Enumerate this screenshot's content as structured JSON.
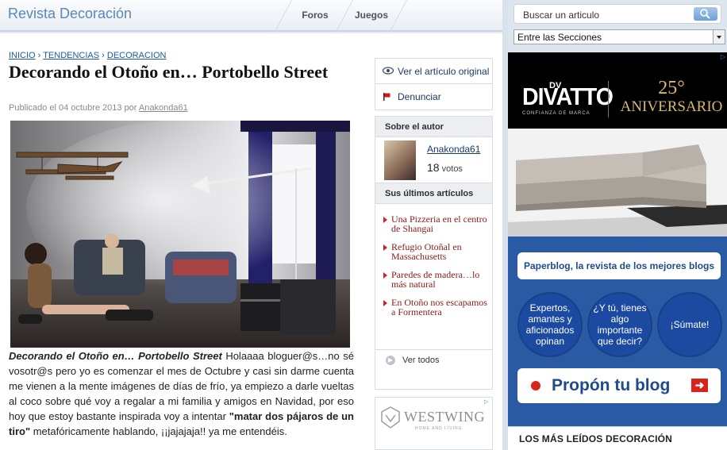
{
  "header": {
    "site_title": "Revista Decoración",
    "nav": [
      "Foros",
      "Juegos"
    ]
  },
  "breadcrumb": [
    "INICIO",
    "TENDENCIAS",
    "DECORACION"
  ],
  "article": {
    "title": "Decorando el Otoño en… Portobello Street",
    "meta_prefix": "Publicado el 04 octubre 2013 por",
    "author": "Anakonda61",
    "lead": "Decorando el Otoño en…  Portobello Street",
    "body_1": " Holaaaa bloguer@s…no sé vosotr@s pero yo es comenzar el mes de Octubre y casi sin darme cuenta me vienen a la mente imágenes de días de frío, ya empiezo a darle vueltas al coco sobre qué voy a regalar a mi familia y amigos en Navidad, por eso hoy que estoy bastante inspirada voy a intentar ",
    "quote": "\"matar dos pájaros de un tiro\"",
    "body_2": " metafóricamente hablando, ¡¡jajajaja!! ya me entendéis."
  },
  "actions": {
    "view_original": "Ver el artículo original",
    "report": "Denunciar"
  },
  "author_box": {
    "heading": "Sobre el autor",
    "name": "Anakonda61",
    "votes": "18",
    "votes_label": "votos"
  },
  "latest": {
    "heading": "Sus últimos artículos",
    "items": [
      "Una Pizzeria en el centro de Shangai",
      "Refugio Otoñal en Massachusetts",
      "Paredes de madera…lo más natural",
      "En Otoño nos escapamos a Formentera"
    ],
    "see_all": "Ver todos"
  },
  "westwing_ad": {
    "logo": "WESTWING",
    "tagline": "HOME AND LIVING"
  },
  "sidebar": {
    "search_placeholder": "Buscar un articulo",
    "section_select": "Entre las Secciones",
    "divatto": {
      "logo": "DIVATTO",
      "dv": "DV",
      "tagline": "CONFIANZA DE MARCA",
      "years": "25°",
      "anniversary": "ANIVERSARIO"
    },
    "paperblog": {
      "banner": "Paperblog, la revista de los mejores blogs",
      "circle_1": "Expertos, amantes y aficionados opinan",
      "circle_2": "¿Y tú, tienes algo importante que decir?",
      "circle_3": "¡Súmate!",
      "propon": "Propón tu blog"
    },
    "most_read": "LOS MÁS LEÍDOS DECORACIÓN"
  },
  "colors": {
    "link_blue": "#1a5aa8",
    "post_red": "#8b1a1a",
    "paperblog_blue": "#2a5aa3",
    "accent_red": "#d9241b"
  }
}
